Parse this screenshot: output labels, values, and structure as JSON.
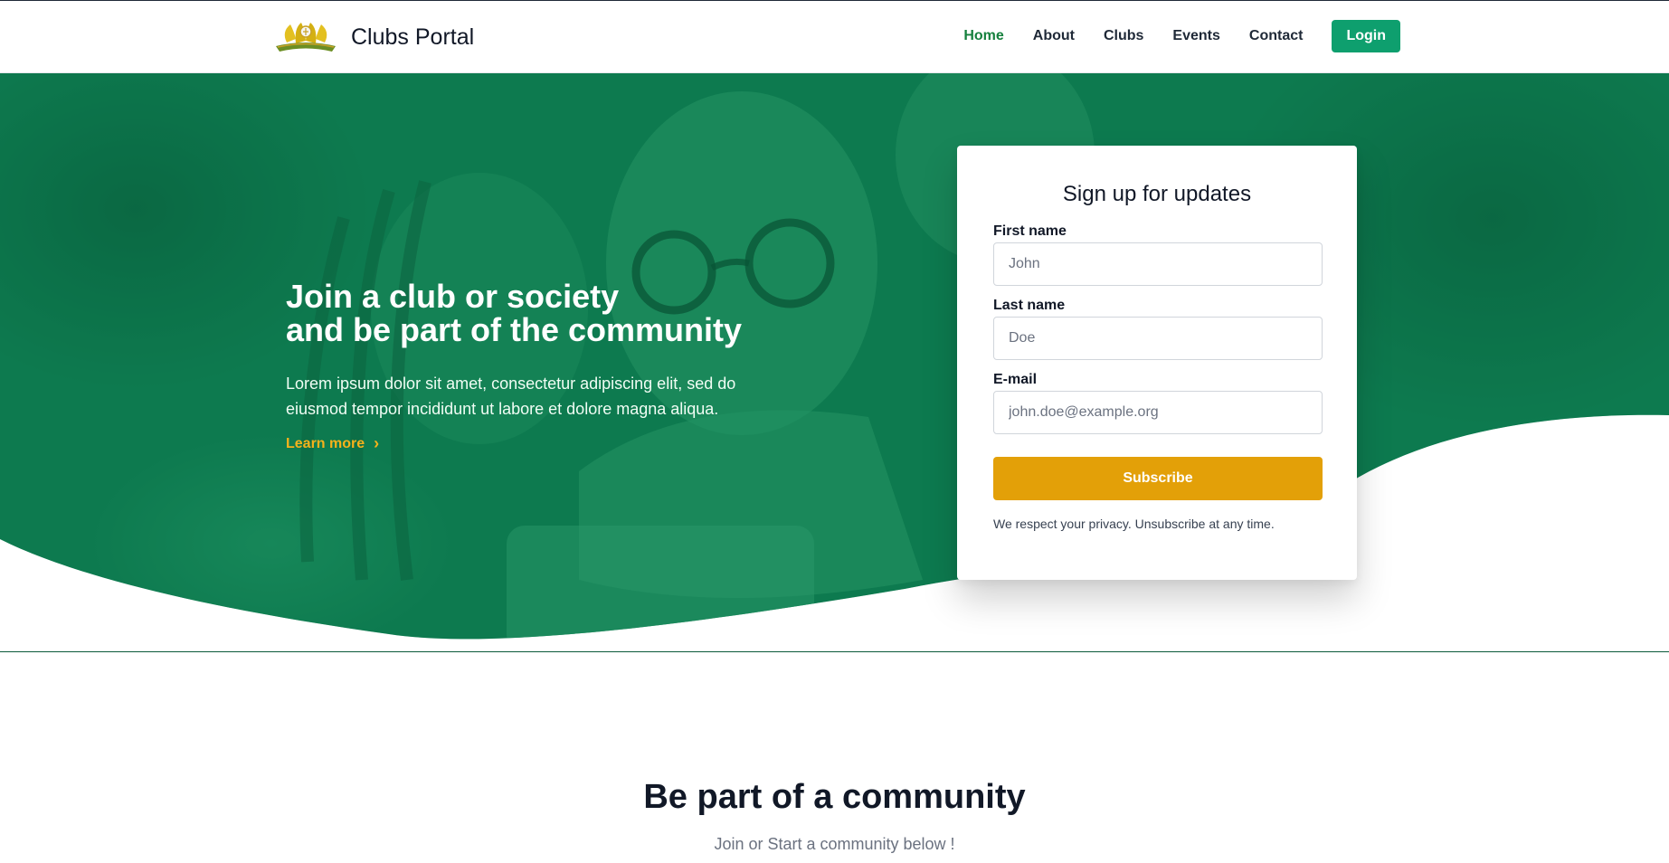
{
  "brand": {
    "name": "Clubs Portal",
    "logo_icon": "crest-logo-icon"
  },
  "nav": {
    "items": [
      {
        "label": "Home",
        "active": true
      },
      {
        "label": "About",
        "active": false
      },
      {
        "label": "Clubs",
        "active": false
      },
      {
        "label": "Events",
        "active": false
      },
      {
        "label": "Contact",
        "active": false
      }
    ],
    "login_label": "Login"
  },
  "hero": {
    "title_line1": "Join a club or society",
    "title_line2": "and be part of the community",
    "description": "Lorem ipsum dolor sit amet, consectetur adipiscing elit, sed do eiusmod tempor incididunt ut labore et dolore magna aliqua.",
    "learn_more": "Learn more",
    "chevron_icon": "chevron-right-icon"
  },
  "signup": {
    "title": "Sign up for updates",
    "first_name": {
      "label": "First name",
      "placeholder": "John",
      "value": ""
    },
    "last_name": {
      "label": "Last name",
      "placeholder": "Doe",
      "value": ""
    },
    "email": {
      "label": "E-mail",
      "placeholder": "john.doe@example.org",
      "value": ""
    },
    "subscribe_label": "Subscribe",
    "privacy_note": "We respect your privacy. Unsubscribe at any time."
  },
  "community": {
    "title": "Be part of a community",
    "subtitle": "Join or Start a community below !"
  },
  "colors": {
    "primary_green": "#0e9f6e",
    "hero_overlay": "#0b7a4f",
    "accent_amber": "#e3a008",
    "nav_active": "#15803d"
  }
}
